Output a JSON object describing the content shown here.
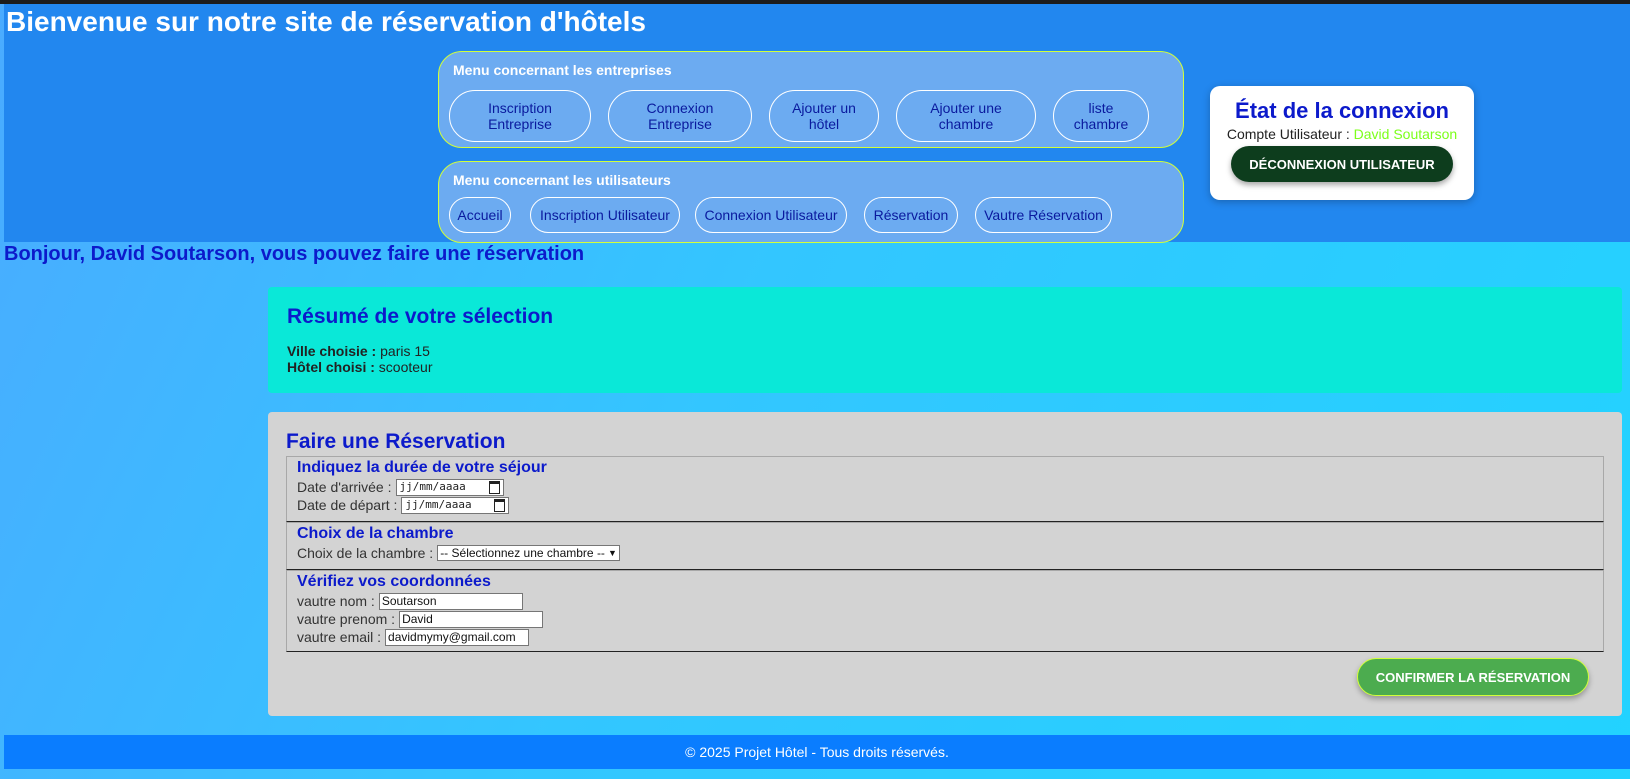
{
  "header": {
    "title": "Bienvenue sur notre site de réservation d'hôtels"
  },
  "menu_entreprises": {
    "title": "Menu concernant les entreprises",
    "items": [
      {
        "label": "Inscription Entreprise"
      },
      {
        "label": "Connexion Entreprise"
      },
      {
        "label": "Ajouter un hôtel"
      },
      {
        "label": "Ajouter une chambre"
      },
      {
        "label": "liste chambre"
      }
    ]
  },
  "menu_utilisateurs": {
    "title": "Menu concernant les utilisateurs",
    "items": [
      {
        "label": "Accueil"
      },
      {
        "label": "Inscription Utilisateur"
      },
      {
        "label": "Connexion Utilisateur"
      },
      {
        "label": "Réservation"
      },
      {
        "label": "Vautre Réservation"
      }
    ]
  },
  "status": {
    "title": "État de la connexion",
    "account_label": "Compte Utilisateur :",
    "user_name": "David Soutarson",
    "logout_label": "DÉCONNEXION UTILISATEUR"
  },
  "greeting": "Bonjour, David Soutarson, vous pouvez faire une réservation",
  "summary": {
    "title": "Résumé de votre sélection",
    "city_label": "Ville choisie :",
    "city_value": "paris 15",
    "hotel_label": "Hôtel choisi :",
    "hotel_value": "scooteur"
  },
  "reservation": {
    "title": "Faire une Réservation",
    "stay": {
      "legend": "Indiquez la durée de votre séjour",
      "arrival_label": "Date d'arrivée :",
      "arrival_placeholder": "jj/mm/aaaa",
      "departure_label": "Date de départ :",
      "departure_placeholder": "jj/mm/aaaa"
    },
    "room": {
      "legend": "Choix de la chambre",
      "label": "Choix de la chambre :",
      "selected": "-- Sélectionnez une chambre --"
    },
    "contact": {
      "legend": "Vérifiez vos coordonnées",
      "nom_label": "vautre nom :",
      "nom_value": "Soutarson",
      "prenom_label": "vautre prenom :",
      "prenom_value": "David",
      "email_label": "vautre email :",
      "email_value": "davidmymy@gmail.com"
    },
    "confirm_label": "CONFIRMER LA RÉSERVATION"
  },
  "footer": {
    "text": "© 2025 Projet Hôtel - Tous droits réservés."
  },
  "colors": {
    "header_bg": "#2287ef",
    "heading_blue": "#0c1acb",
    "accent_green": "#4cac4f",
    "user_highlight": "#7cff1a"
  }
}
